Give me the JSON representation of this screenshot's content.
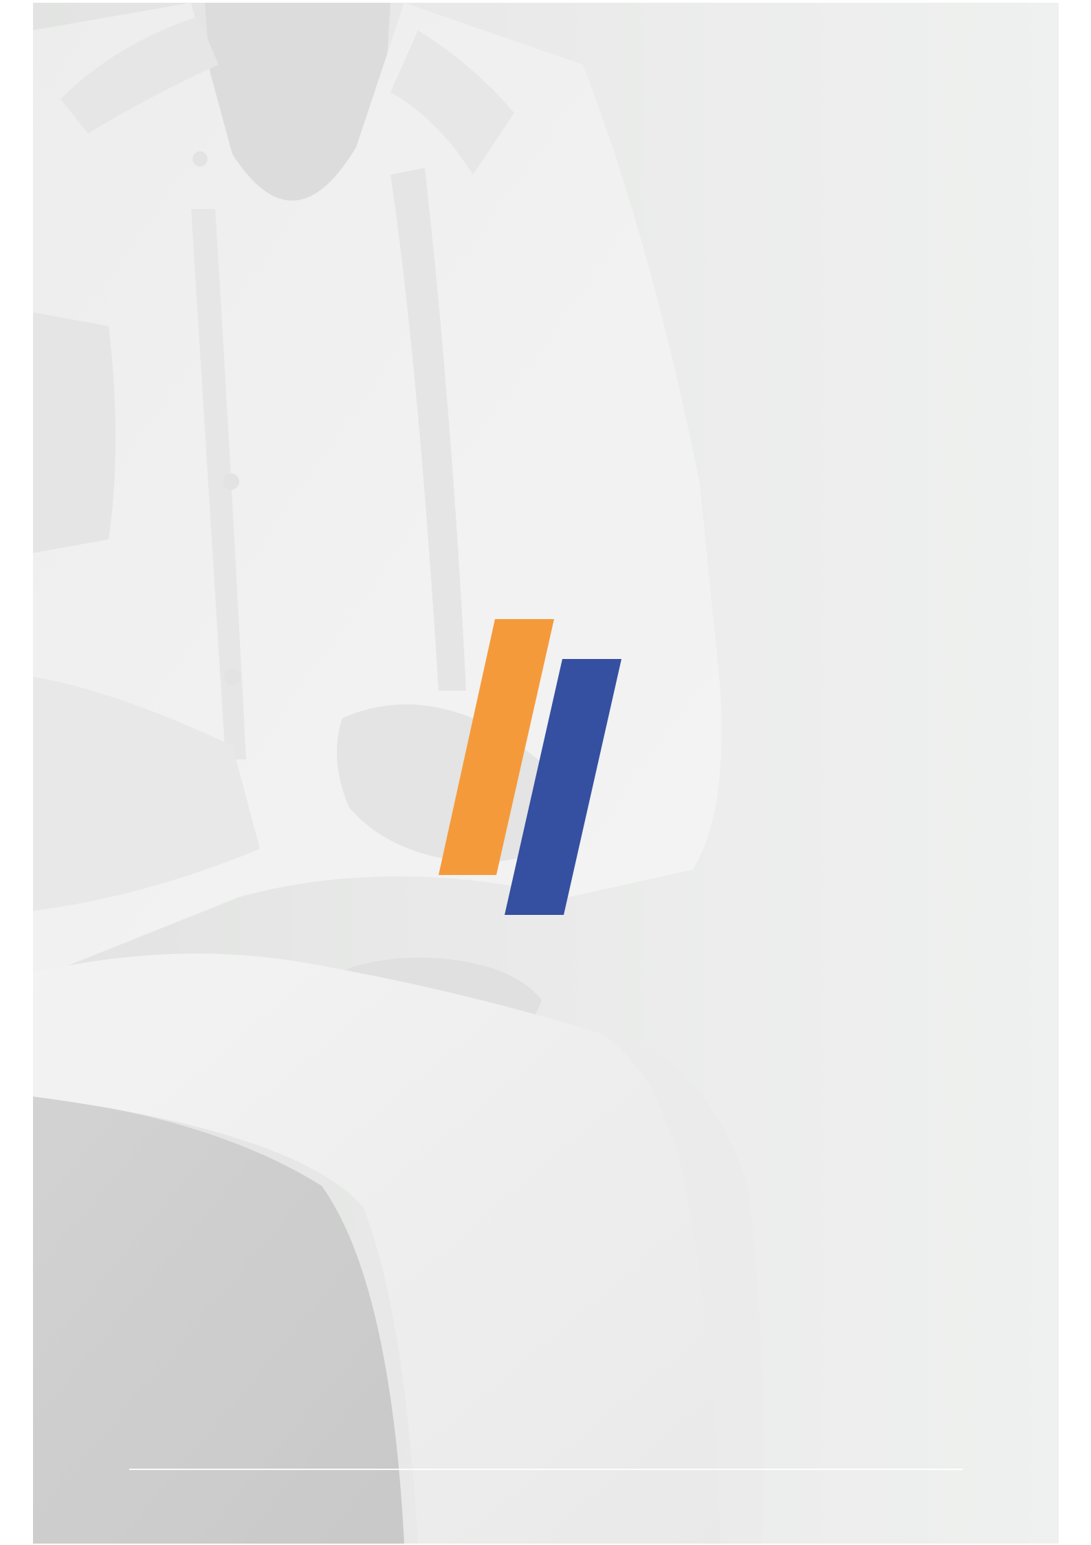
{
  "document": {
    "type": "cover-page"
  },
  "colors": {
    "background": "#e9ebea",
    "accent_orange": "#f59a3b",
    "accent_blue": "#354fa1",
    "rule": "#ffffff"
  },
  "logo": {
    "icon": "two-slanted-stripes-logo-icon"
  },
  "photo": {
    "icon": "person-white-shirt-photo-icon"
  }
}
